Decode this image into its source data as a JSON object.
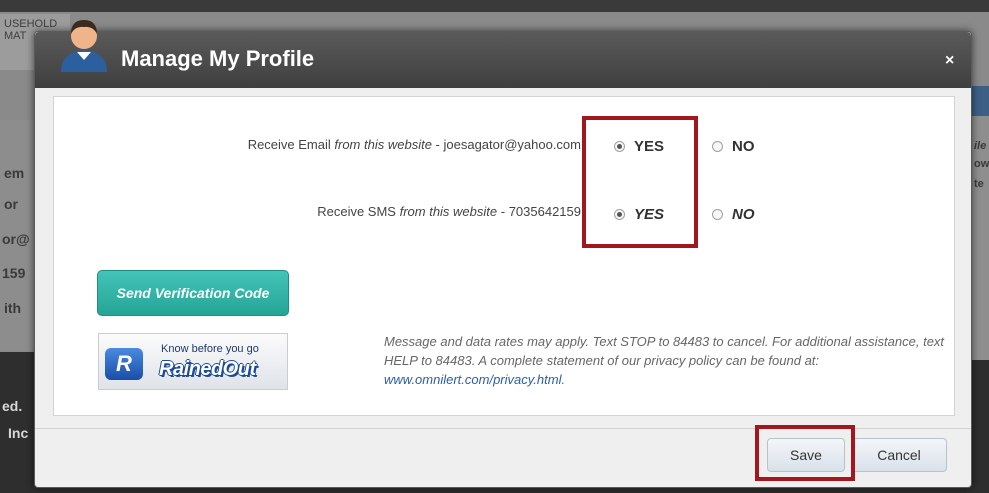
{
  "background": {
    "header_fragment": "USEHOLD\nMAT",
    "left_fragments": [
      "em",
      "or",
      "or@",
      "159",
      "ith"
    ],
    "bottom_fragments": [
      "ed.",
      "Inc"
    ],
    "right_fragments": [
      "ile",
      "ow",
      "te"
    ]
  },
  "modal": {
    "title": "Manage My Profile",
    "close_label": "×",
    "email_row": {
      "prefix": "Receive Email ",
      "italic": "from this website",
      "suffix": " - joesagator@yahoo.com",
      "yes_label": "YES",
      "no_label": "NO",
      "selected": "YES"
    },
    "sms_row": {
      "prefix": "Receive SMS ",
      "italic": "from this website",
      "suffix": " - 7035642159",
      "yes_label": "YES",
      "no_label": "NO",
      "selected": "YES"
    },
    "verify_button": "Send Verification Code",
    "rainedout": {
      "tagline": "Know before you go",
      "brand": "RainedOut",
      "logo_letter": "R"
    },
    "disclaimer": {
      "text": "Message and data rates may apply. Text STOP to 84483 to cancel. For additional assistance, text HELP to 84483. A complete statement of our privacy policy can be found at: ",
      "link": "www.omnilert.com/privacy.html",
      "tail": "."
    },
    "save_button": "Save",
    "cancel_button": "Cancel"
  },
  "colors": {
    "highlight": "#a2161d",
    "verify_teal": "#2aa89a",
    "header_dark": "#4a4a4a"
  }
}
